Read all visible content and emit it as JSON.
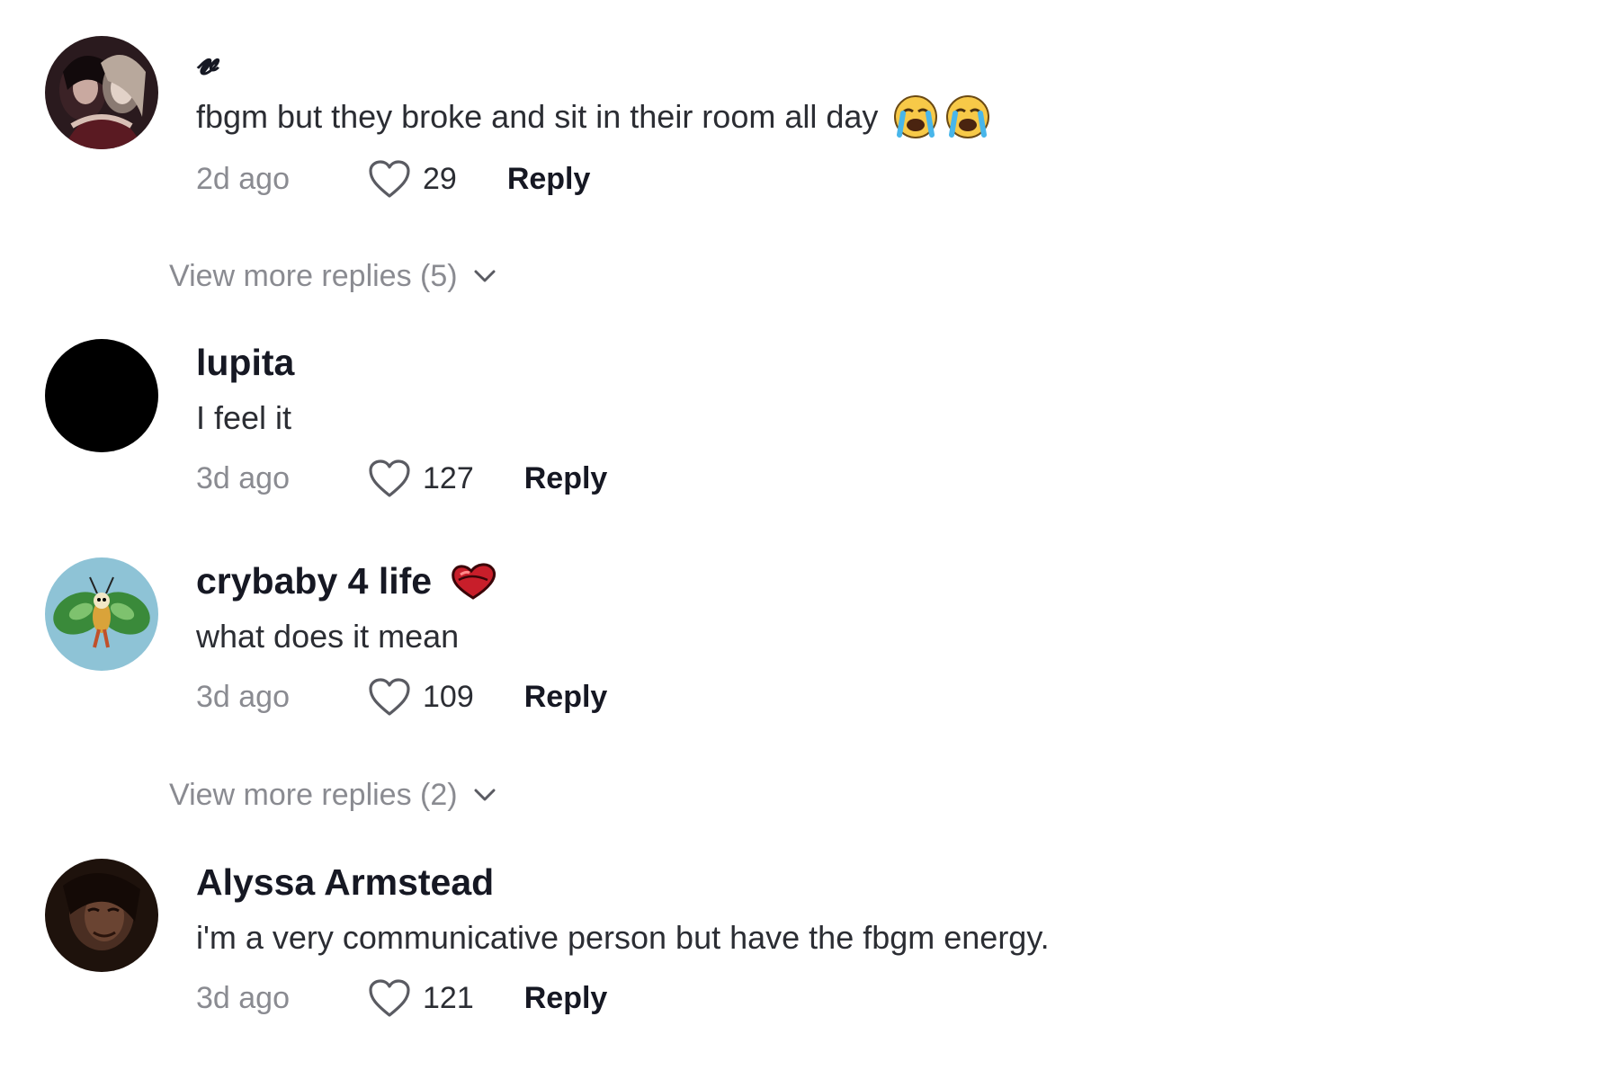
{
  "comments": [
    {
      "username": "𝓿",
      "text": "fbgm but they broke and sit in their room all day",
      "text_emojis": [
        "loudly-crying-face-emoji",
        "loudly-crying-face-emoji"
      ],
      "time": "2d ago",
      "likes": "29",
      "reply_label": "Reply",
      "view_more": "View more replies (5)"
    },
    {
      "username": "lupita",
      "text": "I feel it",
      "time": "3d ago",
      "likes": "127",
      "reply_label": "Reply"
    },
    {
      "username": "crybaby 4 life",
      "username_badge": "red-heart-sticker-icon",
      "text": "what does it mean",
      "time": "3d ago",
      "likes": "109",
      "reply_label": "Reply",
      "view_more": "View more replies (2)"
    },
    {
      "username": "Alyssa Armstead",
      "text": "i'm a very communicative person but have the fbgm energy.",
      "time": "3d ago",
      "likes": "121",
      "reply_label": "Reply"
    }
  ],
  "colors": {
    "username": "#161823",
    "text": "#2b2d33",
    "muted": "#8a8b91",
    "background": "#ffffff"
  }
}
